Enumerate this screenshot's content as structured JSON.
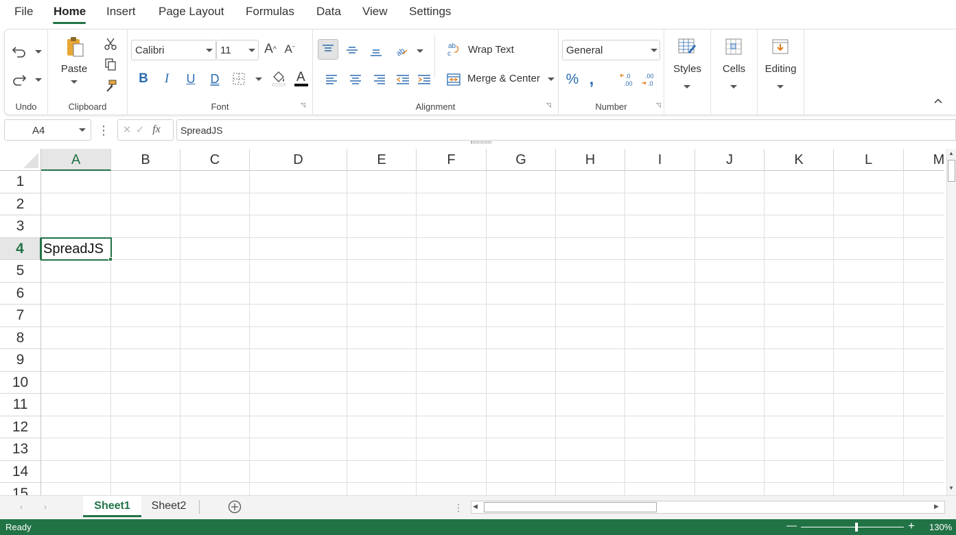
{
  "menu": {
    "tabs": [
      "File",
      "Home",
      "Insert",
      "Page Layout",
      "Formulas",
      "Data",
      "View",
      "Settings"
    ],
    "active": "Home"
  },
  "ribbon": {
    "undo_label": "Undo",
    "clipboard": {
      "paste": "Paste",
      "label": "Clipboard"
    },
    "font": {
      "family": "Calibri",
      "size": "11",
      "label": "Font"
    },
    "alignment": {
      "wrap_text": "Wrap Text",
      "merge_center": "Merge & Center",
      "label": "Alignment"
    },
    "number": {
      "format": "General",
      "label": "Number"
    },
    "styles": "Styles",
    "cells": "Cells",
    "editing": "Editing"
  },
  "formula_bar": {
    "name_box": "A4",
    "fx": "fx",
    "value": "SpreadJS"
  },
  "grid": {
    "columns": [
      "A",
      "B",
      "C",
      "D",
      "E",
      "F",
      "G",
      "H",
      "I",
      "J",
      "K",
      "L",
      "M"
    ],
    "rows": [
      "1",
      "2",
      "3",
      "4",
      "5",
      "6",
      "7",
      "8",
      "9",
      "10",
      "11",
      "12",
      "13",
      "14",
      "15"
    ],
    "selected_cell": "A4",
    "cell_a4": "SpreadJS"
  },
  "sheets": {
    "tabs": [
      "Sheet1",
      "Sheet2"
    ],
    "active": "Sheet1"
  },
  "status": {
    "text": "Ready",
    "zoom": "130%"
  },
  "colors": {
    "accent": "#217346",
    "grid_line": "#dedede",
    "header_selected_bg": "#e6e6e6"
  }
}
